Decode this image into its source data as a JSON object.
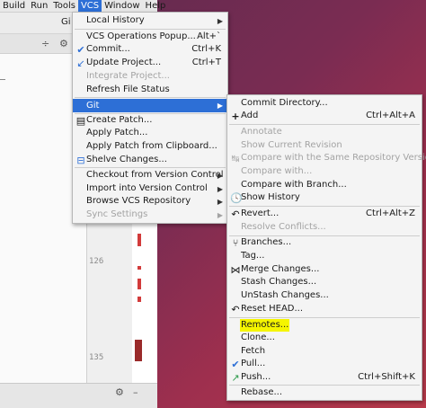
{
  "menubar": {
    "items": [
      "Build",
      "Run",
      "Tools",
      "VCS",
      "Window",
      "Help"
    ]
  },
  "toolbar": {
    "truncated_label": "Gi"
  },
  "gutter": {
    "line_numbers": [
      "126",
      "135"
    ]
  },
  "vcs_menu": {
    "items": [
      {
        "label": "Local History",
        "shortcut": "",
        "submenu": true,
        "disabled": false,
        "icon": ""
      },
      {
        "label": "VCS Operations Popup...",
        "shortcut": "Alt+`",
        "submenu": false,
        "disabled": false,
        "icon": ""
      },
      {
        "label": "Commit...",
        "shortcut": "Ctrl+K",
        "submenu": false,
        "disabled": false,
        "icon": "commit-check-icon"
      },
      {
        "label": "Update Project...",
        "shortcut": "Ctrl+T",
        "submenu": false,
        "disabled": false,
        "icon": "update-arrow-icon"
      },
      {
        "label": "Integrate Project...",
        "shortcut": "",
        "submenu": false,
        "disabled": true,
        "icon": ""
      },
      {
        "label": "Refresh File Status",
        "shortcut": "",
        "submenu": false,
        "disabled": false,
        "icon": ""
      },
      {
        "label": "Git",
        "shortcut": "",
        "submenu": true,
        "disabled": false,
        "icon": "",
        "selected": true
      },
      {
        "label": "Create Patch...",
        "shortcut": "",
        "submenu": false,
        "disabled": false,
        "icon": "patch-icon"
      },
      {
        "label": "Apply Patch...",
        "shortcut": "",
        "submenu": false,
        "disabled": false,
        "icon": ""
      },
      {
        "label": "Apply Patch from Clipboard...",
        "shortcut": "",
        "submenu": false,
        "disabled": false,
        "icon": ""
      },
      {
        "label": "Shelve Changes...",
        "shortcut": "",
        "submenu": false,
        "disabled": false,
        "icon": "shelve-icon"
      },
      {
        "label": "Checkout from Version Control",
        "shortcut": "",
        "submenu": true,
        "disabled": false,
        "icon": ""
      },
      {
        "label": "Import into Version Control",
        "shortcut": "",
        "submenu": true,
        "disabled": false,
        "icon": ""
      },
      {
        "label": "Browse VCS Repository",
        "shortcut": "",
        "submenu": true,
        "disabled": false,
        "icon": ""
      },
      {
        "label": "Sync Settings",
        "shortcut": "",
        "submenu": true,
        "disabled": true,
        "icon": ""
      }
    ]
  },
  "git_menu": {
    "items": [
      {
        "label": "Commit Directory...",
        "shortcut": "",
        "disabled": false,
        "icon": ""
      },
      {
        "label": "Add",
        "shortcut": "Ctrl+Alt+A",
        "disabled": false,
        "icon": "plus-icon"
      },
      {
        "label": "Annotate",
        "shortcut": "",
        "disabled": true,
        "icon": ""
      },
      {
        "label": "Show Current Revision",
        "shortcut": "",
        "disabled": true,
        "icon": ""
      },
      {
        "label": "Compare with the Same Repository Version",
        "shortcut": "",
        "disabled": true,
        "icon": "compare-icon"
      },
      {
        "label": "Compare with...",
        "shortcut": "",
        "disabled": true,
        "icon": ""
      },
      {
        "label": "Compare with Branch...",
        "shortcut": "",
        "disabled": false,
        "icon": ""
      },
      {
        "label": "Show History",
        "shortcut": "",
        "disabled": false,
        "icon": "history-clock-icon"
      },
      {
        "label": "Revert...",
        "shortcut": "Ctrl+Alt+Z",
        "disabled": false,
        "icon": "revert-icon"
      },
      {
        "label": "Resolve Conflicts...",
        "shortcut": "",
        "disabled": true,
        "icon": ""
      },
      {
        "label": "Branches...",
        "shortcut": "",
        "disabled": false,
        "icon": "branch-icon"
      },
      {
        "label": "Tag...",
        "shortcut": "",
        "disabled": false,
        "icon": ""
      },
      {
        "label": "Merge Changes...",
        "shortcut": "",
        "disabled": false,
        "icon": "merge-icon"
      },
      {
        "label": "Stash Changes...",
        "shortcut": "",
        "disabled": false,
        "icon": ""
      },
      {
        "label": "UnStash Changes...",
        "shortcut": "",
        "disabled": false,
        "icon": ""
      },
      {
        "label": "Reset HEAD...",
        "shortcut": "",
        "disabled": false,
        "icon": "reset-icon"
      },
      {
        "label": "Remotes...",
        "shortcut": "",
        "disabled": false,
        "icon": "",
        "highlighted": true
      },
      {
        "label": "Clone...",
        "shortcut": "",
        "disabled": false,
        "icon": ""
      },
      {
        "label": "Fetch",
        "shortcut": "",
        "disabled": false,
        "icon": ""
      },
      {
        "label": "Pull...",
        "shortcut": "",
        "disabled": false,
        "icon": "pull-check-icon"
      },
      {
        "label": "Push...",
        "shortcut": "Ctrl+Shift+K",
        "disabled": false,
        "icon": "push-arrow-icon"
      },
      {
        "label": "Rebase...",
        "shortcut": "",
        "disabled": false,
        "icon": ""
      }
    ]
  }
}
